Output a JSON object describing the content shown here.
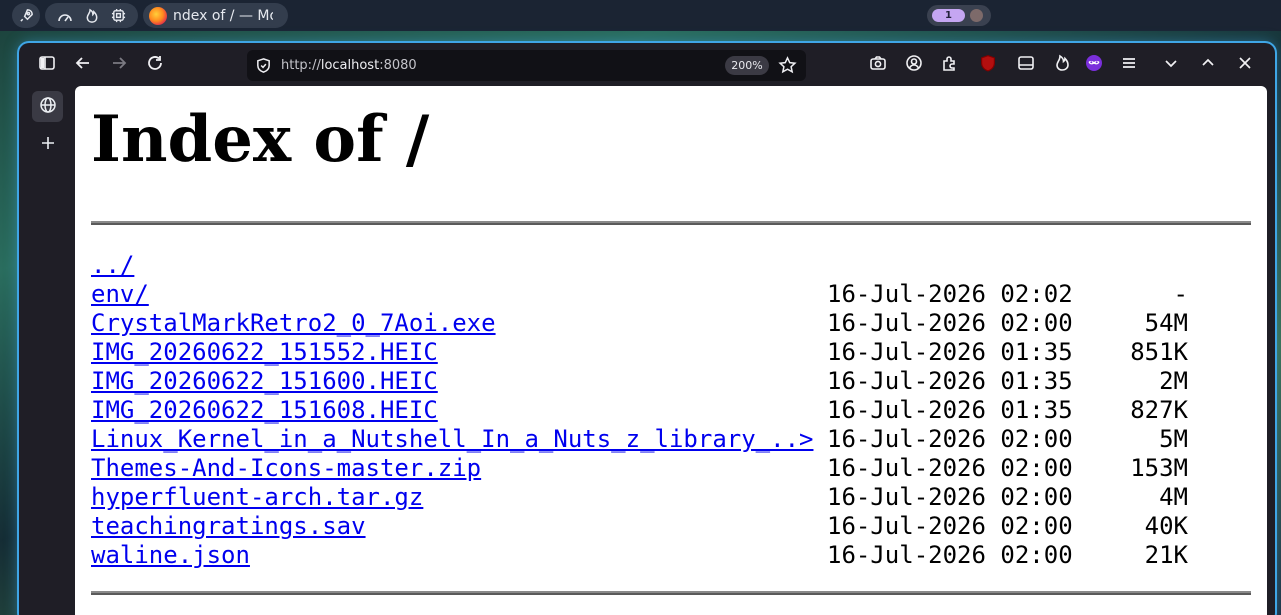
{
  "taskbar": {
    "window_title": "ndex of / — Mo",
    "workspace_badge": "1"
  },
  "browser": {
    "url_scheme": "http://",
    "url_host": "localhost",
    "url_port": ":8080",
    "zoom": "200%"
  },
  "page": {
    "title": "Index of /",
    "entries": [
      {
        "name": "../",
        "date": "",
        "size": ""
      },
      {
        "name": "env/",
        "date": "16-Jul-2026 02:02",
        "size": "-"
      },
      {
        "name": "CrystalMarkRetro2_0_7Aoi.exe",
        "date": "16-Jul-2026 02:00",
        "size": "54M"
      },
      {
        "name": "IMG_20260622_151552.HEIC",
        "date": "16-Jul-2026 01:35",
        "size": "851K"
      },
      {
        "name": "IMG_20260622_151600.HEIC",
        "date": "16-Jul-2026 01:35",
        "size": "2M"
      },
      {
        "name": "IMG_20260622_151608.HEIC",
        "date": "16-Jul-2026 01:35",
        "size": "827K"
      },
      {
        "name": "Linux_Kernel_in_a_Nutshell_In_a_Nuts_z_library_..>",
        "date": "16-Jul-2026 02:00",
        "size": "5M"
      },
      {
        "name": "Themes-And-Icons-master.zip",
        "date": "16-Jul-2026 02:00",
        "size": "153M"
      },
      {
        "name": "hyperfluent-arch.tar.gz",
        "date": "16-Jul-2026 02:00",
        "size": "4M"
      },
      {
        "name": "teachingratings.sav",
        "date": "16-Jul-2026 02:00",
        "size": "40K"
      },
      {
        "name": "waline.json",
        "date": "16-Jul-2026 02:00",
        "size": "21K"
      }
    ]
  },
  "colors": {
    "link": "#0000ee",
    "window_border": "#3fa6e6"
  }
}
